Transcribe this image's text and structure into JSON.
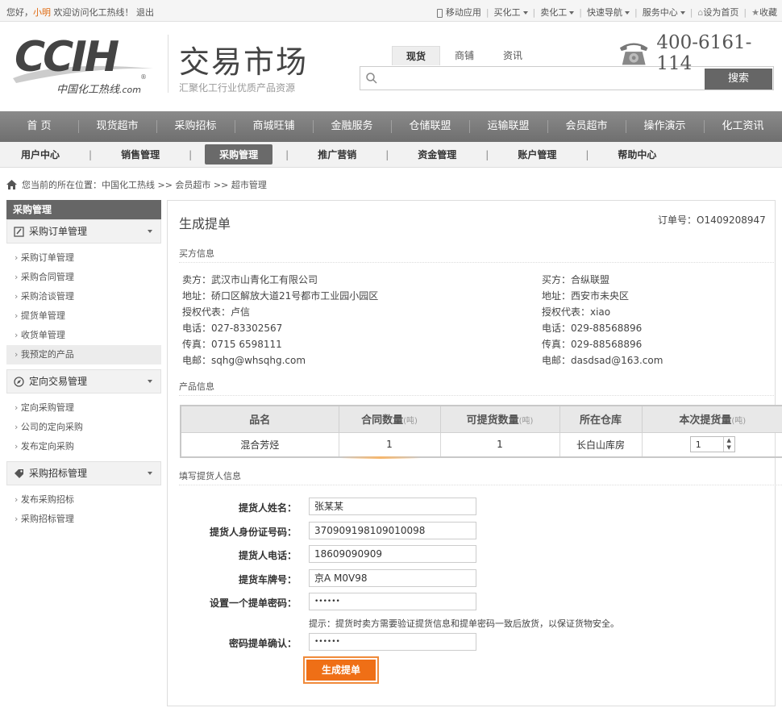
{
  "topbar": {
    "greeting": "您好，",
    "user": "小明",
    "welcome": "欢迎访问化工热线！",
    "logout": "退出",
    "items": [
      "移动应用",
      "买化工",
      "卖化工",
      "快速导航",
      "服务中心",
      "设为首页",
      "收藏"
    ]
  },
  "logo": {
    "main": "CCIH",
    "sub": "中国化工热线",
    "dotcom": ".com",
    "reg": "®"
  },
  "header": {
    "title": "交易市场",
    "slogan": "汇聚化工行业优质产品资源",
    "phone": "400-6161-114"
  },
  "search": {
    "tabs": [
      "现货",
      "商铺",
      "资讯"
    ],
    "placeholder": "",
    "button": "搜索"
  },
  "mainnav": [
    "首 页",
    "现货超市",
    "采购招标",
    "商城旺铺",
    "金融服务",
    "仓储联盟",
    "运输联盟",
    "会员超市",
    "操作演示",
    "化工资讯"
  ],
  "subnav": [
    "用户中心",
    "销售管理",
    "采购管理",
    "推广营销",
    "资金管理",
    "账户管理",
    "帮助中心"
  ],
  "breadcrumb": {
    "prefix": "您当前的所在位置：",
    "path": "中国化工热线 >> 会员超市 >> 超市管理"
  },
  "sidebar": {
    "title": "采购管理",
    "groups": [
      {
        "label": "采购订单管理",
        "items": [
          "采购订单管理",
          "采购合同管理",
          "采购洽谈管理",
          "提货单管理",
          "收货单管理",
          "我预定的产品"
        ]
      },
      {
        "label": "定向交易管理",
        "items": [
          "定向采购管理",
          "公司的定向采购",
          "发布定向采购"
        ]
      },
      {
        "label": "采购招标管理",
        "items": [
          "发布采购招标",
          "采购招标管理"
        ]
      }
    ]
  },
  "page": {
    "title": "生成提单",
    "order_label": "订单号：",
    "order_no": "O1409208947",
    "sec_buyer": "买方信息",
    "sec_product": "产品信息",
    "sec_pickup": "填写提货人信息"
  },
  "seller": [
    "卖方：武汉市山青化工有限公司",
    "地址：硚口区解放大道21号都市工业园小园区",
    "授权代表：卢信",
    "电话：027-83302567",
    "传真：0715 6598111",
    "电邮：sqhg@whsqhg.com"
  ],
  "buyer": [
    "买方：合纵联盟",
    "地址：西安市未央区",
    "授权代表：xiao",
    "电话：029-88568896",
    "传真：029-88568896",
    "电邮：dasdsad@163.com"
  ],
  "table": {
    "headers": [
      "品名",
      "合同数量",
      "可提货数量",
      "所在仓库",
      "本次提货量"
    ],
    "unit": "(吨)",
    "row": [
      "混合芳烃",
      "1",
      "1",
      "长白山库房",
      "1"
    ]
  },
  "form": {
    "name_label": "提货人姓名：",
    "name": "张某某",
    "id_label": "提货人身份证号码：",
    "id": "370909198109010098",
    "phone_label": "提货人电话：",
    "phone": "18609090909",
    "plate_label": "提货车牌号：",
    "plate": "京A M0V98",
    "pwd_label": "设置一个提单密码：",
    "pwd": "••••••",
    "hint": "提示：提货时卖方需要验证提货信息和提单密码一致后放货，以保证货物安全。",
    "pwd2_label": "密码提单确认：",
    "pwd2": "••••••",
    "submit": "生成提单"
  }
}
